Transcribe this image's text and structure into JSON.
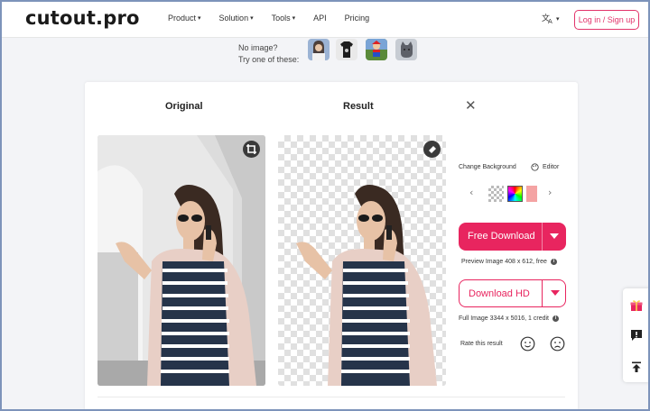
{
  "header": {
    "logo": "cutout.pro",
    "nav": [
      {
        "label": "Product",
        "has_menu": true
      },
      {
        "label": "Solution",
        "has_menu": true
      },
      {
        "label": "Tools",
        "has_menu": true
      },
      {
        "label": "API",
        "has_menu": false
      },
      {
        "label": "Pricing",
        "has_menu": false
      }
    ],
    "language_icon": "translate-icon",
    "login_label": "Log in / Sign up"
  },
  "samples": {
    "line1": "No image?",
    "line2": "Try one of these:"
  },
  "result_panel": {
    "original_title": "Original",
    "result_title": "Result",
    "change_background": "Change Background",
    "editor": "Editor",
    "free_download": "Free Download",
    "preview_info": "Preview Image 408 x 612, free",
    "download_hd": "Download HD",
    "full_info": "Full Image 3344 x 5016, 1 credit",
    "rate_label": "Rate this result"
  },
  "colors": {
    "accent": "#e8255f",
    "frame": "#7d93ba"
  }
}
